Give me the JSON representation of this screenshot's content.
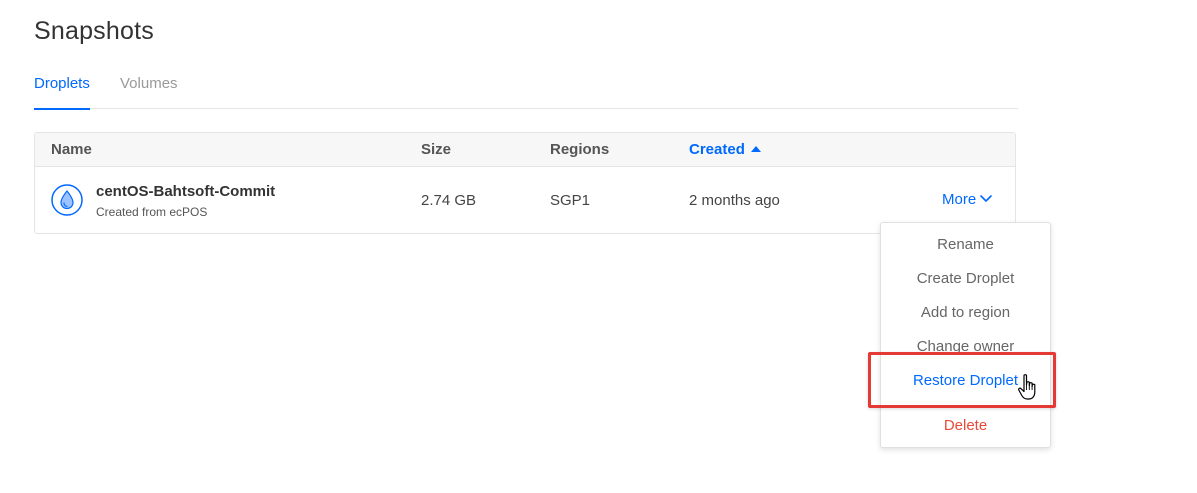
{
  "page": {
    "title": "Snapshots"
  },
  "tabs": [
    {
      "label": "Droplets",
      "active": true
    },
    {
      "label": "Volumes",
      "active": false
    }
  ],
  "table": {
    "columns": {
      "name": "Name",
      "size": "Size",
      "regions": "Regions",
      "created": "Created"
    },
    "sort": {
      "column": "created",
      "direction": "ascending"
    },
    "rows": [
      {
        "icon": "droplet-icon",
        "name": "centOS-Bahtsoft-Commit",
        "subtitle": "Created from ecPOS",
        "size": "2.74 GB",
        "region": "SGP1",
        "created": "2 months ago",
        "more_label": "More"
      }
    ]
  },
  "dropdown": {
    "items": [
      {
        "label": "Rename"
      },
      {
        "label": "Create Droplet"
      },
      {
        "label": "Add to region"
      },
      {
        "label": "Change owner"
      },
      {
        "label": "Restore Droplet",
        "highlighted": true
      },
      {
        "label": "Delete",
        "danger": true
      }
    ]
  },
  "colors": {
    "accent": "#0069ff",
    "danger": "#e84a38",
    "highlight_box": "#e53935"
  },
  "icons": {
    "sort": "sort-ascending-arrow-icon",
    "more": "chevron-down-icon",
    "cursor": "hand-pointer-cursor-icon"
  }
}
